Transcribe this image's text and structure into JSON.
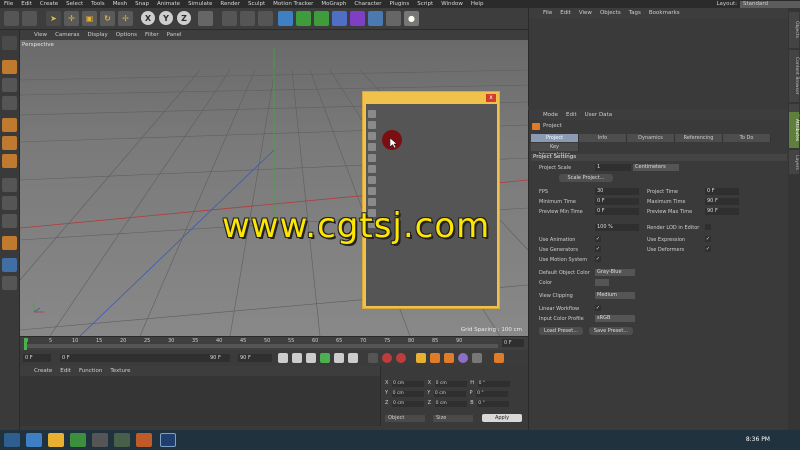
{
  "menu": [
    "File",
    "Edit",
    "Create",
    "Select",
    "Tools",
    "Mesh",
    "Snap",
    "Animate",
    "Simulate",
    "Render",
    "Sculpt",
    "Motion Tracker",
    "MoGraph",
    "Character",
    "Plugins",
    "Script",
    "Window",
    "Help"
  ],
  "layout": {
    "label": "Layout:",
    "value": "Standard"
  },
  "toolbar": {
    "x": "X",
    "y": "Y",
    "z": "Z"
  },
  "viewport": {
    "menu": [
      "View",
      "Cameras",
      "Display",
      "Options",
      "Filter",
      "Panel"
    ],
    "label": "Perspective",
    "grid_spacing": "Grid Spacing : 100 cm"
  },
  "floatwin": {
    "close": "x"
  },
  "watermark": "www.cgtsj.com",
  "timeline": {
    "ticks": [
      "0",
      "5",
      "10",
      "15",
      "20",
      "25",
      "30",
      "35",
      "40",
      "45",
      "50",
      "55",
      "60",
      "65",
      "70",
      "75",
      "80",
      "85",
      "90"
    ],
    "end_frame": "0 F"
  },
  "transport": {
    "start": "0 F",
    "current": "0 F",
    "max_left": "90 F",
    "max_right": "90 F"
  },
  "materials": {
    "menu": [
      "Create",
      "Edit",
      "Function",
      "Texture"
    ]
  },
  "coords": {
    "rows": [
      {
        "a": "X",
        "av": "0 cm",
        "b": "X",
        "bv": "0 cm",
        "c": "H",
        "cv": "0 °"
      },
      {
        "a": "Y",
        "av": "0 cm",
        "b": "Y",
        "bv": "0 cm",
        "c": "P",
        "cv": "0 °"
      },
      {
        "a": "Z",
        "av": "0 cm",
        "b": "Z",
        "bv": "0 cm",
        "c": "B",
        "cv": "0 °"
      }
    ],
    "mode1": "Object",
    "mode2": "Size",
    "apply": "Apply"
  },
  "objects": {
    "menu": [
      "File",
      "Edit",
      "View",
      "Objects",
      "Tags",
      "Bookmarks"
    ]
  },
  "right_tabs": [
    "Objects",
    "Content Browser",
    "Structure",
    "Attributes",
    "Layers"
  ],
  "attributes": {
    "menu": [
      "Mode",
      "Edit",
      "User Data"
    ],
    "title": "Project",
    "tabs": [
      "Project Settings",
      "Info",
      "Dynamics",
      "Referencing",
      "To Do"
    ],
    "tab2": "Key Interpolation",
    "section": "Project Settings",
    "project_scale_label": "Project Scale",
    "project_scale": "1",
    "units": "Centimeters",
    "scale_button": "Scale Project...",
    "fps_label": "FPS",
    "fps": "30",
    "project_time_label": "Project Time",
    "project_time": "0 F",
    "min_time_label": "Minimum Time",
    "min_time": "0 F",
    "max_time_label": "Maximum Time",
    "max_time": "90 F",
    "prev_min_label": "Preview Min Time",
    "prev_min": "0 F",
    "prev_max_label": "Preview Max Time",
    "prev_max": "90 F",
    "lod": "100 %",
    "render_lod": "Render LOD in Editor",
    "use_animation": "Use Animation",
    "use_expression": "Use Expression",
    "use_generators": "Use Generators",
    "use_deformers": "Use Deformers",
    "use_motion": "Use Motion System",
    "obj_color_label": "Default Object Color",
    "obj_color": "Gray-Blue",
    "color_label": "Color",
    "view_clipping_label": "View Clipping",
    "view_clipping": "Medium",
    "linear_label": "Linear Workflow",
    "input_profile_label": "Input Color Profile",
    "input_profile": "sRGB",
    "load_preset": "Load Preset...",
    "save_preset": "Save Preset...",
    "check": "✓"
  },
  "clock": "8:36 PM"
}
